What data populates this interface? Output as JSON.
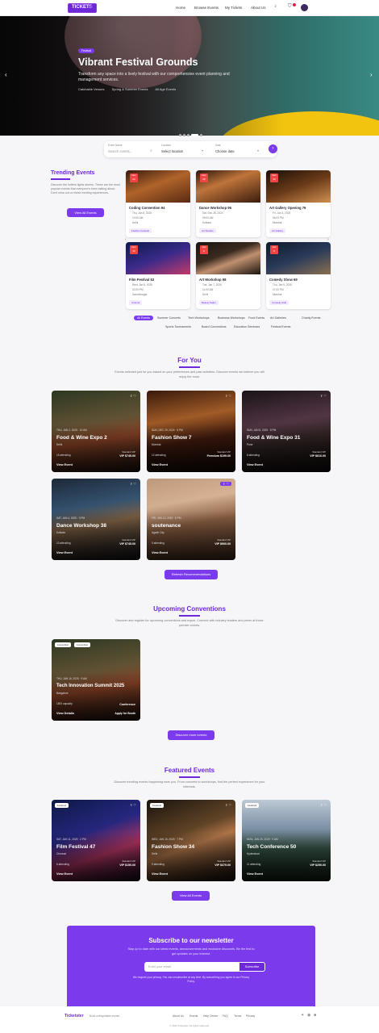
{
  "nav": {
    "logo": "TICKETS",
    "logo_suffix": "ER",
    "links": [
      "Home",
      "Browse Events",
      "My Tickets",
      "About Us"
    ],
    "cart_badge": "1"
  },
  "hero": {
    "tag": "Festival",
    "title": "Vibrant Festival Grounds",
    "description": "Transform any space into a lively festival with our comprehensive event planning and management services.",
    "meta": [
      "Catchable Venues",
      "Spring & Summer Events",
      "All Age Events"
    ]
  },
  "search": {
    "fields": [
      {
        "label": "Event Name",
        "value": "Search events..."
      },
      {
        "label": "Location",
        "value": "Select location"
      },
      {
        "label": "Date",
        "value": "Choose date"
      }
    ]
  },
  "trending": {
    "title": "Trending Events",
    "description": "Discover the hottest tights stories. These are the most popular events that everyone's been talking about. Don't miss out on these exciting experiences.",
    "button": "View All Events",
    "cards": [
      {
        "day": "24",
        "month": "Dec",
        "title": "Coding Convention 94",
        "lines": [
          "Thu, Jan 8, 2025",
          "10:00 AM",
          "Delhi"
        ],
        "tag": "Fashion Festival"
      },
      {
        "day": "28",
        "month": "Dec",
        "title": "Dance Workshop 96",
        "lines": [
          "Sat, Dec 28, 2024",
          "09:00 AM",
          "Kolkata"
        ],
        "tag": "Art Studios"
      },
      {
        "day": "30",
        "month": "Dec",
        "title": "Art Gallery Opening 76",
        "lines": [
          "Fri, Jan 3, 2025",
          "06:00 PM",
          "Mumbai"
        ],
        "tag": "Art Gallery"
      },
      {
        "day": "30",
        "month": "Dec",
        "title": "Film Festival 52",
        "lines": [
          "Wed, Jan 8, 2025",
          "02:00 PM",
          "Gandhinagar"
        ],
        "tag": "Cinema"
      },
      {
        "day": "6",
        "month": "Jan",
        "title": "Art Workshop 98",
        "lines": [
          "Tue, Jan 7, 2025",
          "11:00 AM",
          "Delhi"
        ],
        "tag": "Beauty Salon"
      },
      {
        "day": "8",
        "month": "Jan",
        "title": "Comedy Show 69",
        "lines": [
          "Thu, Jan 9, 2025",
          "07:00 PM",
          "Mumbai"
        ],
        "tag": "Comedy Club"
      }
    ]
  },
  "chips": [
    "All Events",
    "Summer Concerts",
    "Tech Workshops",
    "Business Workshops",
    "Food Events",
    "Art Galleries",
    "Charity Events",
    "Sports Tournaments",
    "Board Conventions",
    "Education Seminars",
    "Festival Events"
  ],
  "for_you": {
    "title": "For You",
    "description": "Events selected just for you based on your preferences and past activities. Discover events we believe you will enjoy the most.",
    "button": "Refresh Recommendations",
    "cards": [
      {
        "pre": "THU, JAN 2, 2025 · 10 AM",
        "title": "Food & Wine Expo 2",
        "sub": "Delhi",
        "attending": "15 attending",
        "price_label": "Standard  VIP",
        "price": "VIP $745.00",
        "cta": "View Event"
      },
      {
        "pre": "SUN, DEC 29, 2024 · 6 PM",
        "title": "Fashion Show 7",
        "sub": "Mumbai",
        "attending": "12 attending",
        "price_label": "Standard  VIP",
        "price": "Premium $199.00",
        "cta": "View Event"
      },
      {
        "pre": "SUN, JAN 5, 2025 · 5 PM",
        "title": "Food & Wine Expo 31",
        "sub": "Pune",
        "attending": "8 attending",
        "price_label": "Standard  VIP",
        "price": "VIP $610.00",
        "cta": "View Event"
      },
      {
        "pre": "SAT, JAN 4, 2025 · 3 PM",
        "title": "Dance Workshop 38",
        "sub": "Kolkata",
        "attending": "10 attending",
        "price_label": "Standard  VIP",
        "price": "VIP $745.00",
        "cta": "View Event"
      },
      {
        "pre": "FRI, JAN 10, 2025 · 8 PM",
        "title": "soutenance",
        "sub": "Agadir City",
        "attending": "9 attending",
        "price_label": "Standard  VIP",
        "price": "VIP $900.00",
        "cta": "View Event"
      }
    ]
  },
  "conventions": {
    "title": "Upcoming Conventions",
    "description": "Discover and register for upcoming conventions and expos. Connect with industry leaders and peers at these premier events.",
    "button": "Discover more events",
    "card": {
      "labels": [
        "Convention",
        "Convention"
      ],
      "pre": "THU, JAN 16, 2025 · 9 AM",
      "title": "Tech Innovation Summit 2025",
      "sub": "Bangalore",
      "attending": "1500 capacity",
      "price": "Conference",
      "cta": "View Details",
      "cta2": "Apply for Booth"
    }
  },
  "featured": {
    "title": "Featured Events",
    "description": "Discover trending events happening near you. From concerts to workshops, find the perfect experience for your interests.",
    "button": "View All Events",
    "cards": [
      {
        "label": "Featured",
        "pre": "SAT, JAN 11, 2025 · 2 PM",
        "title": "Film Festival 47",
        "sub": "Chennai",
        "attending": "6 attending",
        "price_label": "Standard  VIP",
        "price": "VIP $150.00",
        "cta": "View Event"
      },
      {
        "label": "Featured",
        "pre": "WED, JAN 15, 2025 · 7 PM",
        "title": "Fashion Show 34",
        "sub": "Delhi",
        "attending": "9 attending",
        "price_label": "Standard  VIP",
        "price": "VIP $379.00",
        "cta": "View Event"
      },
      {
        "label": "Featured",
        "pre": "MON, JAN 20, 2025 · 9 AM",
        "title": "Tech Conference 50",
        "sub": "Hyderabad",
        "attending": "11 attending",
        "price_label": "Standard  VIP",
        "price": "VIP $250.00",
        "cta": "View Event"
      }
    ]
  },
  "newsletter": {
    "title": "Subscribe to our newsletter",
    "description": "Stay up to date with our latest events, announcements and exclusive discounts. Be the first to get updates on your interest.",
    "placeholder": "Enter your email",
    "button": "Subscribe",
    "fine": "We respect your privacy. You can unsubscribe at any time. By subscribing you agree to our Privacy Policy."
  },
  "footer": {
    "logo": "Ticketster",
    "tagline": "Book unforgettable events",
    "links": [
      "About Us",
      "Events",
      "Help Center",
      "FAQ",
      "Terms",
      "Privacy"
    ],
    "copyright": "© 2024 Ticketster. All rights reserved."
  },
  "colors": {
    "accent": "#7c3aed",
    "accent_dark": "#6d28d9",
    "date_badge": "#ef4444"
  }
}
